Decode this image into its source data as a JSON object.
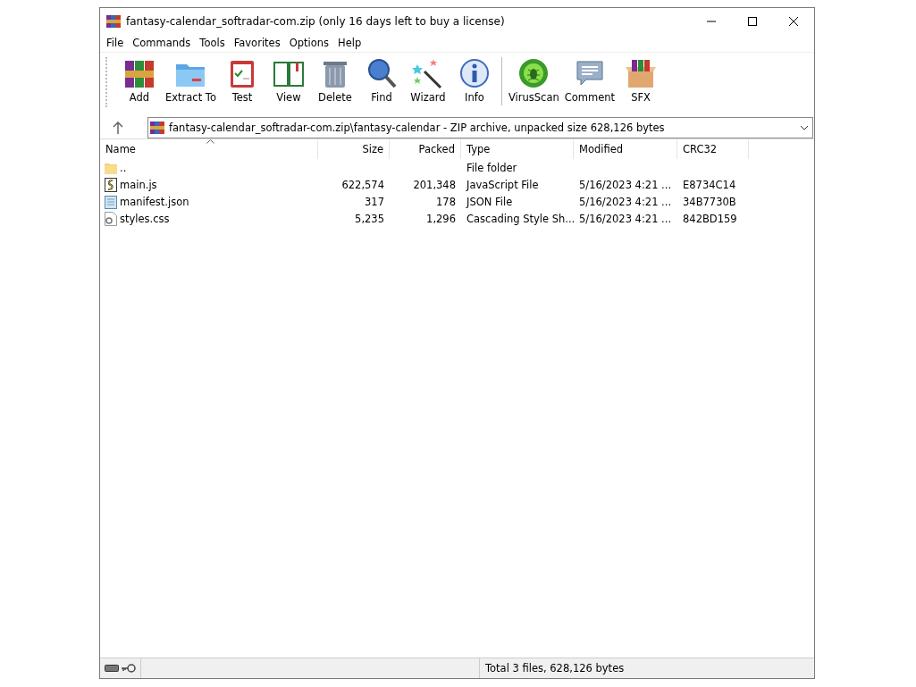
{
  "window": {
    "title": "fantasy-calendar_softradar-com.zip (only 16 days left to buy a license)"
  },
  "menu": [
    "File",
    "Commands",
    "Tools",
    "Favorites",
    "Options",
    "Help"
  ],
  "toolbar": [
    {
      "label": "Add"
    },
    {
      "label": "Extract To"
    },
    {
      "label": "Test"
    },
    {
      "label": "View"
    },
    {
      "label": "Delete"
    },
    {
      "label": "Find"
    },
    {
      "label": "Wizard"
    },
    {
      "label": "Info"
    },
    {
      "label": "VirusScan"
    },
    {
      "label": "Comment"
    },
    {
      "label": "SFX"
    }
  ],
  "address": {
    "value": "fantasy-calendar_softradar-com.zip\\fantasy-calendar - ZIP archive, unpacked size 628,126 bytes"
  },
  "table": {
    "columns": [
      "Name",
      "Size",
      "Packed",
      "Type",
      "Modified",
      "CRC32"
    ],
    "rows": [
      {
        "kind": "folder",
        "cells": [
          "..",
          "",
          "",
          "File folder",
          "",
          ""
        ]
      },
      {
        "kind": "script",
        "cells": [
          "main.js",
          "622,574",
          "201,348",
          "JavaScript File",
          "5/16/2023 4:21 ...",
          "E8734C14"
        ]
      },
      {
        "kind": "json",
        "cells": [
          "manifest.json",
          "317",
          "178",
          "JSON File",
          "5/16/2023 4:21 ...",
          "34B7730B"
        ]
      },
      {
        "kind": "css",
        "cells": [
          "styles.css",
          "5,235",
          "1,296",
          "Cascading Style Sh...",
          "5/16/2023 4:21 ...",
          "842BD159"
        ]
      }
    ]
  },
  "status_bar": {
    "text": "Total 3 files, 628,126 bytes"
  }
}
